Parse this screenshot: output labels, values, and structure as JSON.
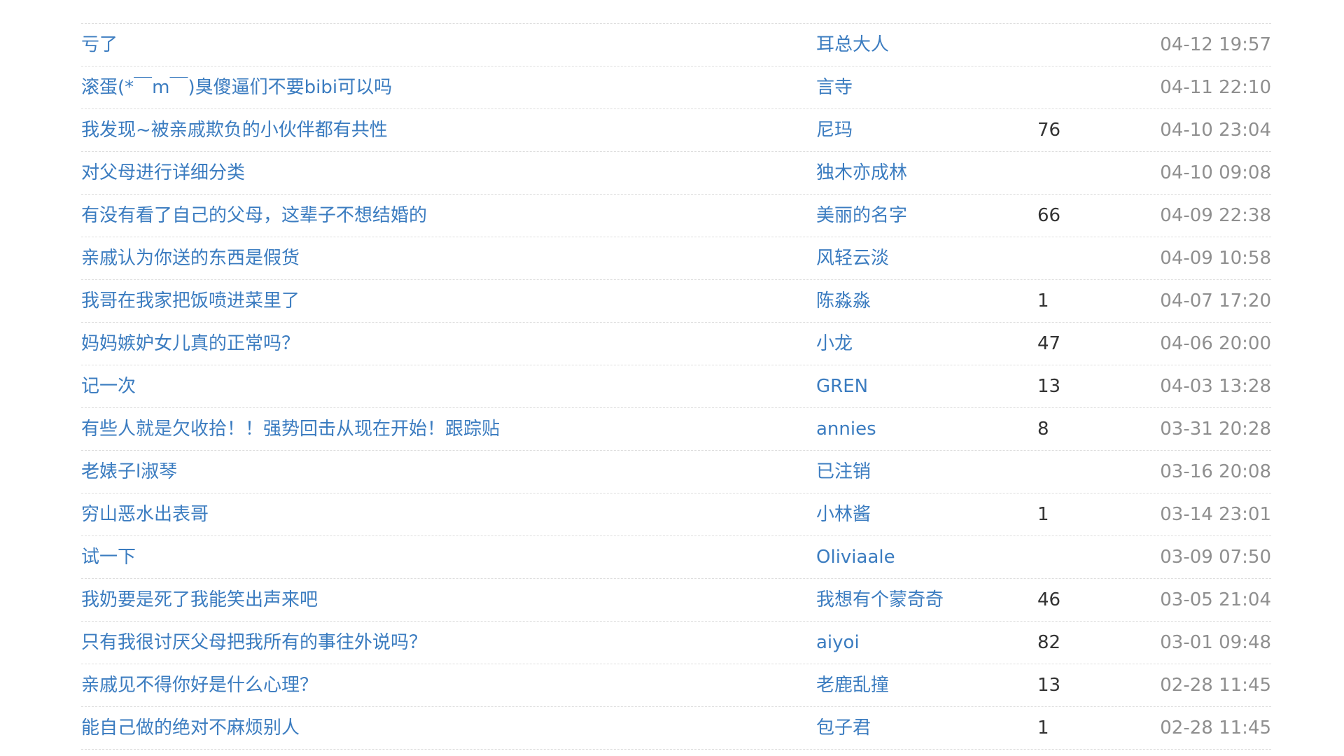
{
  "topics": [
    {
      "title": "亏了",
      "author": "耳总大人",
      "replies": "",
      "time": "04-12 19:57"
    },
    {
      "title": "滚蛋(*￣m￣)臭傻逼们不要bibi可以吗",
      "author": "言寺",
      "replies": "",
      "time": "04-11 22:10"
    },
    {
      "title": "我发现~被亲戚欺负的小伙伴都有共性",
      "author": "尼玛",
      "replies": "76",
      "time": "04-10 23:04"
    },
    {
      "title": "对父母进行详细分类",
      "author": "独木亦成林",
      "replies": "",
      "time": "04-10 09:08"
    },
    {
      "title": "有没有看了自己的父母，这辈子不想结婚的",
      "author": "美丽的名字",
      "replies": "66",
      "time": "04-09 22:38"
    },
    {
      "title": "亲戚认为你送的东西是假货",
      "author": "风轻云淡",
      "replies": "",
      "time": "04-09 10:58"
    },
    {
      "title": "我哥在我家把饭喷进菜里了",
      "author": "陈淼淼",
      "replies": "1",
      "time": "04-07 17:20"
    },
    {
      "title": "妈妈嫉妒女儿真的正常吗？",
      "author": "小龙",
      "replies": "47",
      "time": "04-06 20:00"
    },
    {
      "title": "记一次",
      "author": "GREN",
      "replies": "13",
      "time": "04-03 13:28"
    },
    {
      "title": "有些人就是欠收拾！！强势回击从现在开始！跟踪贴",
      "author": "annies",
      "replies": "8",
      "time": "03-31 20:28"
    },
    {
      "title": "老婊子l淑琴",
      "author": "已注销",
      "replies": "",
      "time": "03-16 20:08"
    },
    {
      "title": "穷山恶水出表哥",
      "author": "小林酱",
      "replies": "1",
      "time": "03-14 23:01"
    },
    {
      "title": "试一下",
      "author": "Oliviaale",
      "replies": "",
      "time": "03-09 07:50"
    },
    {
      "title": "我奶要是死了我能笑出声来吧",
      "author": "我想有个蒙奇奇",
      "replies": "46",
      "time": "03-05 21:04"
    },
    {
      "title": "只有我很讨厌父母把我所有的事往外说吗？",
      "author": "aiyoi",
      "replies": "82",
      "time": "03-01 09:48"
    },
    {
      "title": "亲戚见不得你好是什么心理？",
      "author": "老鹿乱撞",
      "replies": "13",
      "time": "02-28 11:45"
    },
    {
      "title": "能自己做的绝对不麻烦别人",
      "author": "包子君",
      "replies": "1",
      "time": "02-28 11:45"
    }
  ]
}
